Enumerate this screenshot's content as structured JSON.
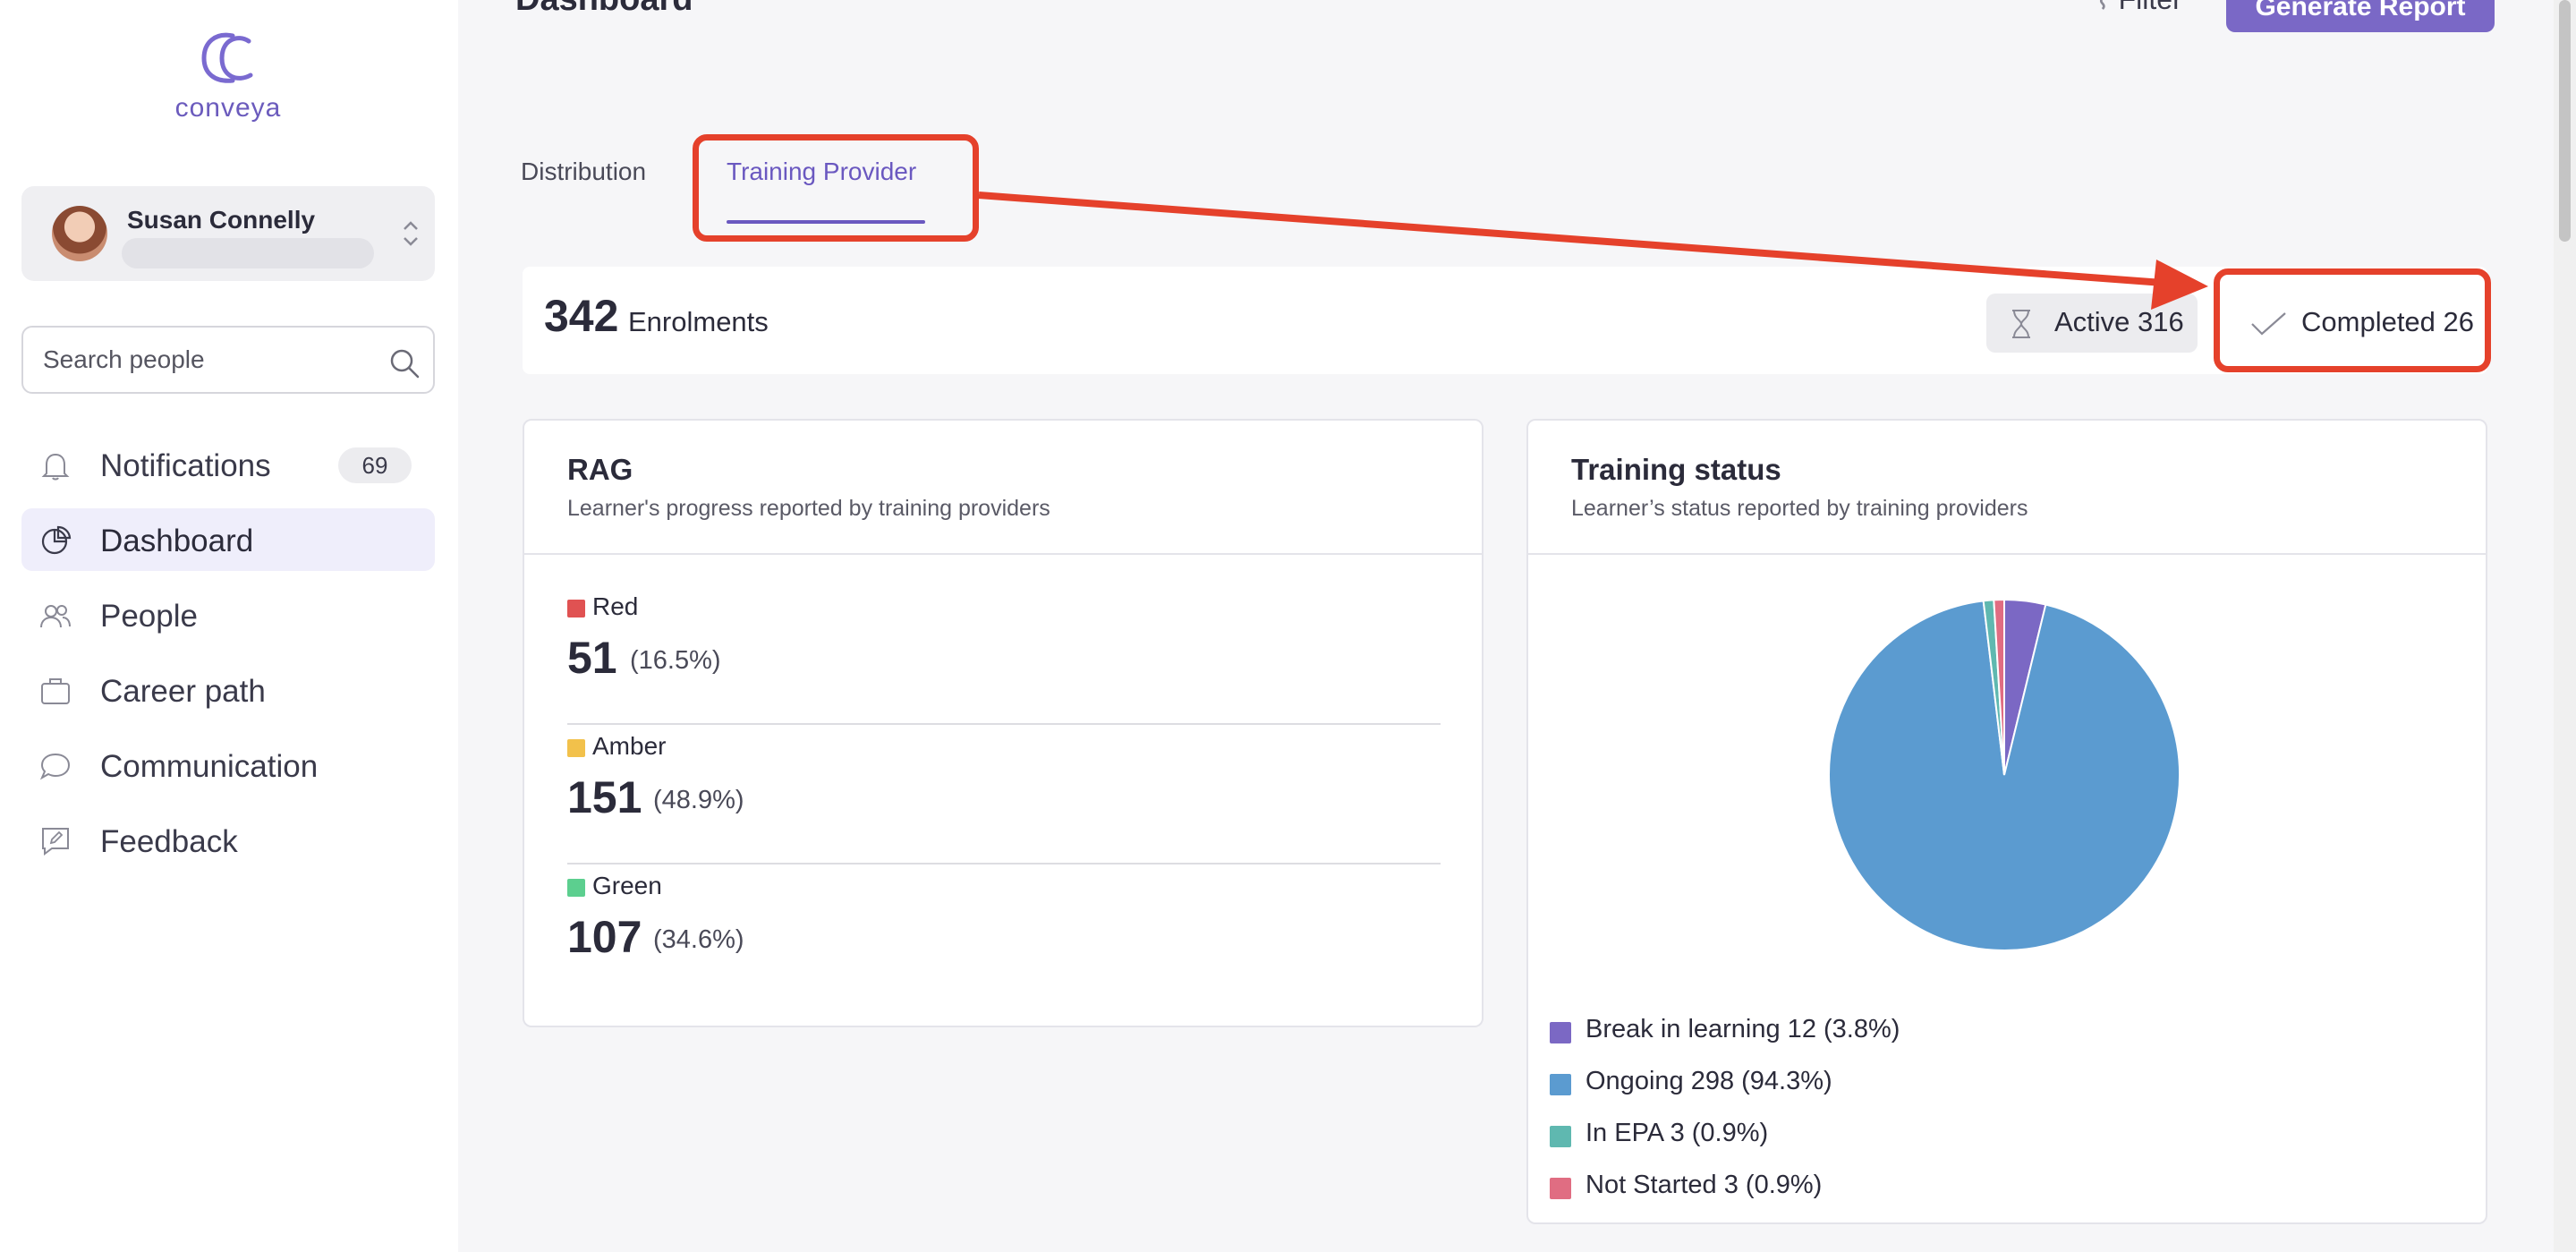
{
  "brand": {
    "name": "conveya",
    "accent": "#6b5bbd"
  },
  "user": {
    "name": "Susan Connelly"
  },
  "search": {
    "placeholder": "Search people"
  },
  "nav": [
    {
      "label": "Notifications",
      "icon": "bell-icon",
      "badge": "69"
    },
    {
      "label": "Dashboard",
      "icon": "pie-chart-icon",
      "active": true
    },
    {
      "label": "People",
      "icon": "people-icon"
    },
    {
      "label": "Career path",
      "icon": "briefcase-icon"
    },
    {
      "label": "Communication",
      "icon": "chat-icon"
    },
    {
      "label": "Feedback",
      "icon": "feedback-icon"
    }
  ],
  "header": {
    "title": "Dashboard",
    "filter_label": "Filter",
    "generate_label": "Generate Report"
  },
  "tabs": {
    "distribution": "Distribution",
    "training_provider": "Training Provider",
    "active": "Training Provider"
  },
  "summary": {
    "count": "342",
    "label": "Enrolments",
    "active": "Active 316",
    "completed": "Completed 26"
  },
  "rag": {
    "title": "RAG",
    "subtitle": "Learner's progress reported by training providers",
    "rows": [
      {
        "name": "Red",
        "value": "51",
        "pct": "(16.5%)",
        "color": "#e05252"
      },
      {
        "name": "Amber",
        "value": "151",
        "pct": "(48.9%)",
        "color": "#f2c14b"
      },
      {
        "name": "Green",
        "value": "107",
        "pct": "(34.6%)",
        "color": "#5ccf8f"
      }
    ]
  },
  "training_status": {
    "title": "Training status",
    "subtitle": "Learner’s status reported by training providers",
    "legend": [
      "Break in learning 12 (3.8%)",
      "Ongoing 298 (94.3%)",
      "In EPA 3 (0.9%)",
      "Not Started 3 (0.9%)"
    ]
  },
  "chart_data": {
    "type": "pie",
    "categories": [
      "Break in learning",
      "Ongoing",
      "In EPA",
      "Not Started"
    ],
    "values": [
      12,
      298,
      3,
      3
    ],
    "colors": [
      "#7b68c4",
      "#5b9bd0",
      "#5fb8b0",
      "#e06d82"
    ]
  }
}
